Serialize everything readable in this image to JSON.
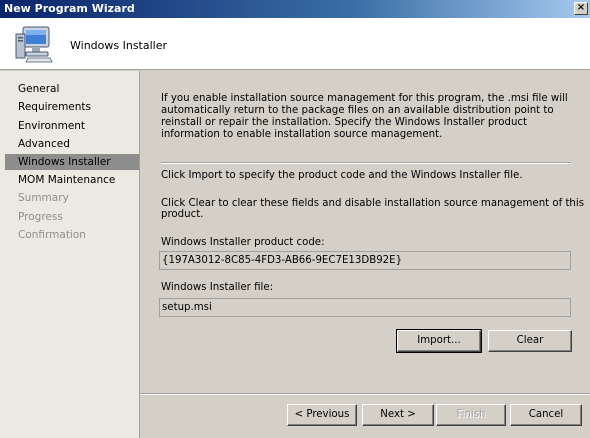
{
  "window": {
    "title": "New Program Wizard",
    "close_label": "×"
  },
  "header": {
    "title": "Windows Installer",
    "icon": "computer-icon"
  },
  "sidebar": {
    "items": [
      {
        "label": "General",
        "state": "normal"
      },
      {
        "label": "Requirements",
        "state": "normal"
      },
      {
        "label": "Environment",
        "state": "normal"
      },
      {
        "label": "Advanced",
        "state": "normal"
      },
      {
        "label": "Windows Installer",
        "state": "active"
      },
      {
        "label": "MOM Maintenance",
        "state": "normal"
      },
      {
        "label": "Summary",
        "state": "disabled"
      },
      {
        "label": "Progress",
        "state": "disabled"
      },
      {
        "label": "Confirmation",
        "state": "disabled"
      }
    ]
  },
  "main": {
    "intro": "If you enable installation source management for this program, the .msi file will automatically return to the package files on an available distribution point to reinstall or repair the installation. Specify the Windows Installer product information to enable installation source management.",
    "import_text": "Click Import to specify the product code and the Windows Installer file.",
    "clear_text": "Click Clear to clear these fields and disable installation source management of this product.",
    "product_code_label": "Windows Installer product code:",
    "product_code_value": "{197A3012-8C85-4FD3-AB66-9EC7E13DB92E}",
    "file_label": "Windows Installer file:",
    "file_value": "setup.msi",
    "import_button": "Import...",
    "clear_button": "Clear"
  },
  "footer": {
    "previous_button": "< Previous",
    "next_button": "Next >",
    "finish_button": "Finish",
    "cancel_button": "Cancel"
  }
}
